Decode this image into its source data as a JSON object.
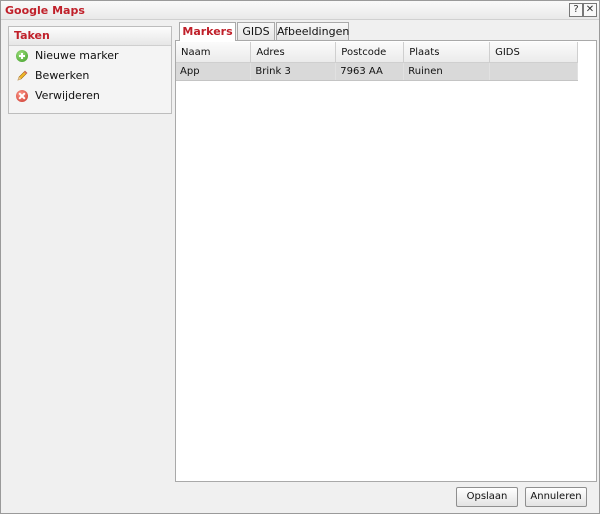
{
  "window": {
    "title": "Google Maps",
    "help_symbol": "?",
    "close_symbol": "✕"
  },
  "tasks": {
    "title": "Taken",
    "items": [
      {
        "label": "Nieuwe marker",
        "icon": "add-icon"
      },
      {
        "label": "Bewerken",
        "icon": "pencil-icon"
      },
      {
        "label": "Verwijderen",
        "icon": "delete-icon"
      }
    ]
  },
  "tabs": [
    {
      "label": "Markers",
      "active": true
    },
    {
      "label": "GIDS",
      "active": false
    },
    {
      "label": "Afbeeldingen",
      "active": false
    }
  ],
  "table": {
    "columns": [
      "Naam",
      "Adres",
      "Postcode",
      "Plaats",
      "GIDS"
    ],
    "rows": [
      [
        "App",
        "Brink 3",
        "7963 AA",
        "Ruinen",
        ""
      ]
    ]
  },
  "buttons": {
    "save": "Opslaan",
    "cancel": "Annuleren"
  },
  "colors": {
    "accent": "#c0202a",
    "selected_row": "#d9d9d9"
  }
}
